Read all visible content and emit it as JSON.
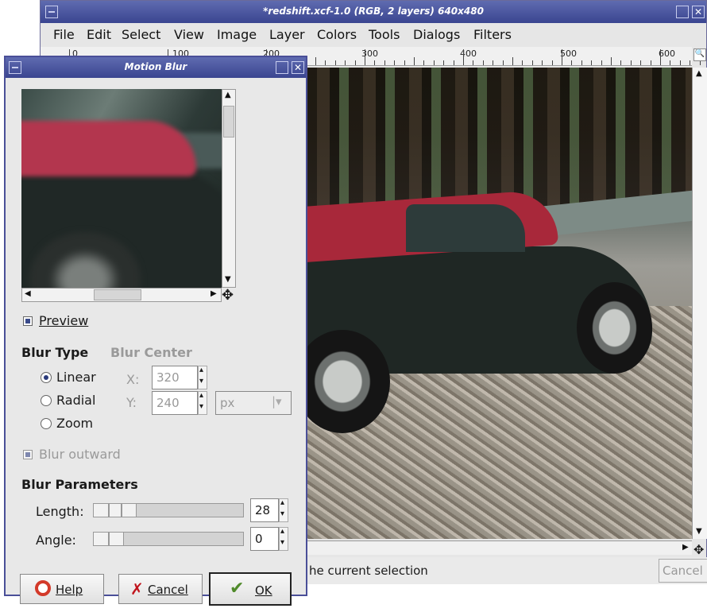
{
  "main_window": {
    "title": "*redshift.xcf-1.0 (RGB, 2 layers) 640x480",
    "menus": [
      "File",
      "Edit",
      "Select",
      "View",
      "Image",
      "Layer",
      "Colors",
      "Tools",
      "Dialogs",
      "Filters"
    ],
    "ruler_labels": [
      "0",
      "100",
      "200",
      "300",
      "400",
      "500",
      "600"
    ],
    "status_text": "he current selection",
    "status_cancel": "Cancel"
  },
  "dialog": {
    "title": "Motion Blur",
    "preview_label": "Preview",
    "preview_checked": true,
    "blur_type_heading": "Blur Type",
    "blur_center_heading": "Blur Center",
    "blur_types": [
      {
        "label": "Linear",
        "selected": true
      },
      {
        "label": "Radial",
        "selected": false
      },
      {
        "label": "Zoom",
        "selected": false
      }
    ],
    "x_label": "X:",
    "x_value": "320",
    "y_label": "Y:",
    "y_value": "240",
    "unit": "px",
    "blur_outward_label": "Blur outward",
    "blur_outward_checked": true,
    "params_heading": "Blur Parameters",
    "length_label": "Length:",
    "length_value": "28",
    "angle_label": "Angle:",
    "angle_value": "0",
    "help_label": "Help",
    "cancel_label": "Cancel",
    "ok_label": "OK"
  },
  "colors": {
    "titlebar": "#3a4590",
    "cancel_icon": "#c0141c",
    "help_icon": "#d33a2a",
    "ok_icon": "#4f8a2a"
  },
  "icons": [
    "window-menu-icon",
    "maximize-icon",
    "close-icon",
    "move-icon",
    "help-icon",
    "cancel-icon",
    "ok-icon",
    "navigate-icon"
  ]
}
